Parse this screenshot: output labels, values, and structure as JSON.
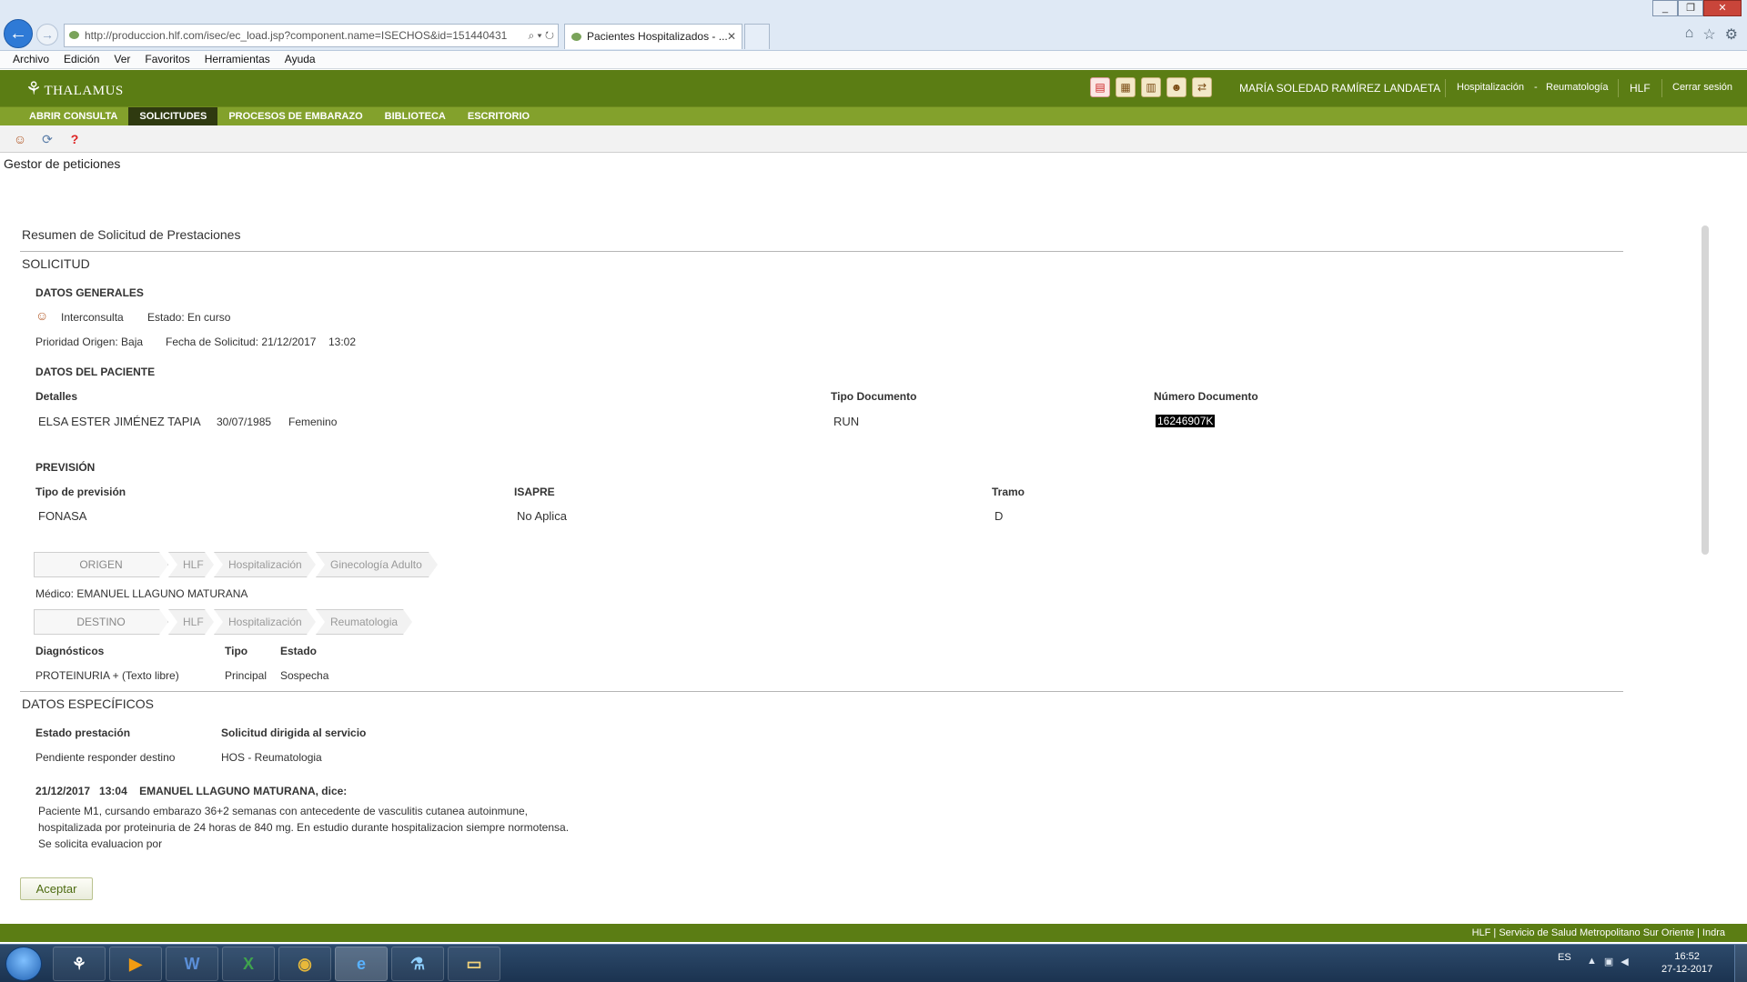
{
  "browser": {
    "url": "http://produccion.hlf.com/isec/ec_load.jsp?component.name=ISECHOS&id=151440431",
    "tab_title": "Pacientes Hospitalizados - ...",
    "menu": [
      "Archivo",
      "Edición",
      "Ver",
      "Favoritos",
      "Herramientas",
      "Ayuda"
    ]
  },
  "app": {
    "logo": "THALAMUS",
    "user": "MARÍA SOLEDAD RAMÍREZ LANDAETA",
    "service_left": "Hospitalización",
    "service_dash": "-",
    "service_right": "Reumatología",
    "site": "HLF",
    "logout": "Cerrar sesión",
    "nav": [
      "ABRIR CONSULTA",
      "SOLICITUDES",
      "PROCESOS DE EMBARAZO",
      "BIBLIOTECA",
      "ESCRITORIO"
    ],
    "active_nav": "SOLICITUDES",
    "page_title": "Gestor de peticiones"
  },
  "summary": {
    "heading": "Resumen de Solicitud de Prestaciones",
    "solicitud_title": "SOLICITUD",
    "datos_generales_title": "DATOS GENERALES",
    "tipo": "Interconsulta",
    "estado": "Estado: En curso",
    "prioridad": "Prioridad Origen: Baja",
    "fecha": "Fecha de Solicitud: 21/12/2017",
    "hora": "13:02",
    "paciente_title": "DATOS DEL PACIENTE",
    "detalles_label": "Detalles",
    "tipo_doc_label": "Tipo Documento",
    "num_doc_label": "Número Documento",
    "paciente_nombre": "ELSA ESTER JIMÉNEZ TAPIA",
    "paciente_fecha_nac": "30/07/1985",
    "paciente_sexo": "Femenino",
    "tipo_doc": "RUN",
    "num_doc": "16246907K",
    "prevision_title": "PREVISIÓN",
    "tipo_prevision_label": "Tipo de previsión",
    "isapre_label": "ISAPRE",
    "tramo_label": "Tramo",
    "tipo_prevision": "FONASA",
    "isapre": "No Aplica",
    "tramo": "D",
    "origen": {
      "label": "ORIGEN",
      "steps": [
        "HLF",
        "Hospitalización",
        "Ginecología Adulto"
      ]
    },
    "medico": "Médico: EMANUEL LLAGUNO MATURANA",
    "destino": {
      "label": "DESTINO",
      "steps": [
        "HLF",
        "Hospitalización",
        "Reumatologia"
      ]
    },
    "diag_label": "Diagnósticos",
    "diag_tipo_label": "Tipo",
    "diag_estado_label": "Estado",
    "diagnostico": "PROTEINURIA + (Texto libre)",
    "diag_tipo": "Principal",
    "diag_estado": "Sospecha",
    "especificos_title": "DATOS ESPECÍFICOS",
    "estado_prestacion_label": "Estado prestación",
    "servicio_label": "Solicitud dirigida al servicio",
    "estado_prestacion": "Pendiente responder destino",
    "servicio": "HOS - Reumatologia",
    "nota_header": "21/12/2017   13:04    EMANUEL LLAGUNO MATURANA, dice:",
    "nota_lines": [
      "Paciente M1, cursando embarazo 36+2 semanas con antecedente de vasculitis cutanea autoinmune,",
      "hospitalizada por proteinuria de 24 horas de 840 mg. En estudio durante hospitalizacion siempre normotensa.",
      "Se solicita evaluacion por"
    ],
    "accept": "Aceptar"
  },
  "footer": "HLF  |  Servicio de Salud Metropolitano Sur Oriente  |  Indra",
  "taskbar": {
    "lang": "ES",
    "time": "16:52",
    "date": "27-12-2017"
  },
  "colors": {
    "header_green": "#5b7d14",
    "nav_green": "#83a12c",
    "nav_active": "#2f3a10"
  }
}
